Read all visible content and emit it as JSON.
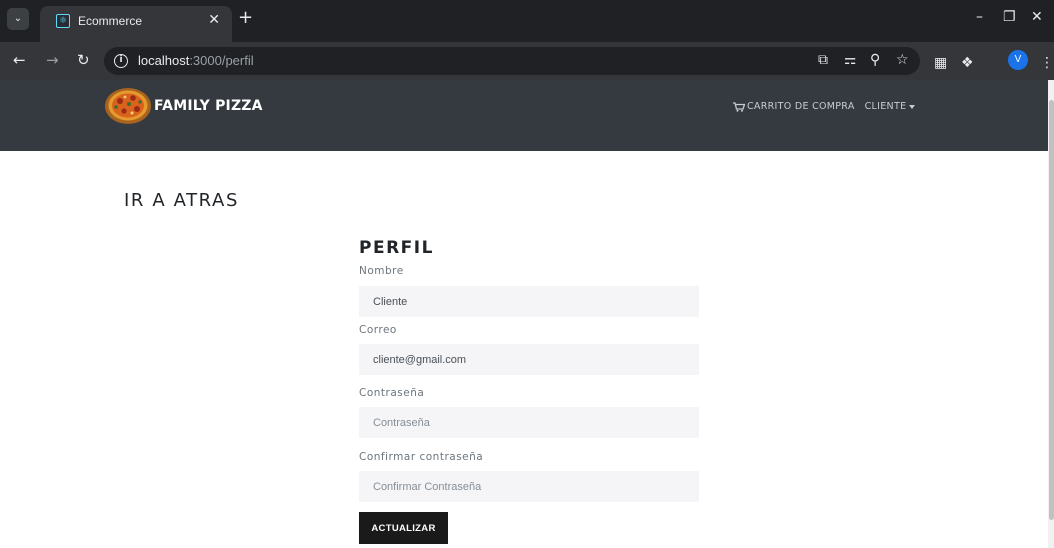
{
  "browser": {
    "tab_title": "Ecommerce",
    "url_host": "localhost",
    "url_rest": ":3000/perfil",
    "profile_initial": "V"
  },
  "site": {
    "brand": "FAMILY PIZZA",
    "nav": {
      "cart": "CARRITO DE COMPRA",
      "user": "CLIENTE"
    },
    "back_link": "IR A ATRAS"
  },
  "form": {
    "title": "PERFIL",
    "fields": [
      {
        "label": "Nombre",
        "value": "Cliente",
        "placeholder": ""
      },
      {
        "label": "Correo",
        "value": "cliente@gmail.com",
        "placeholder": ""
      },
      {
        "label": "Contraseña",
        "value": "",
        "placeholder": "Contraseña"
      },
      {
        "label": "Confirmar contraseña",
        "value": "",
        "placeholder": "Confirmar Contraseña"
      }
    ],
    "submit": "ACTUALIZAR"
  },
  "colors": {
    "navbar": "#343a40",
    "input_bg": "#f5f5f7",
    "button": "#1a1a1a",
    "browser_dark": "#202124"
  }
}
